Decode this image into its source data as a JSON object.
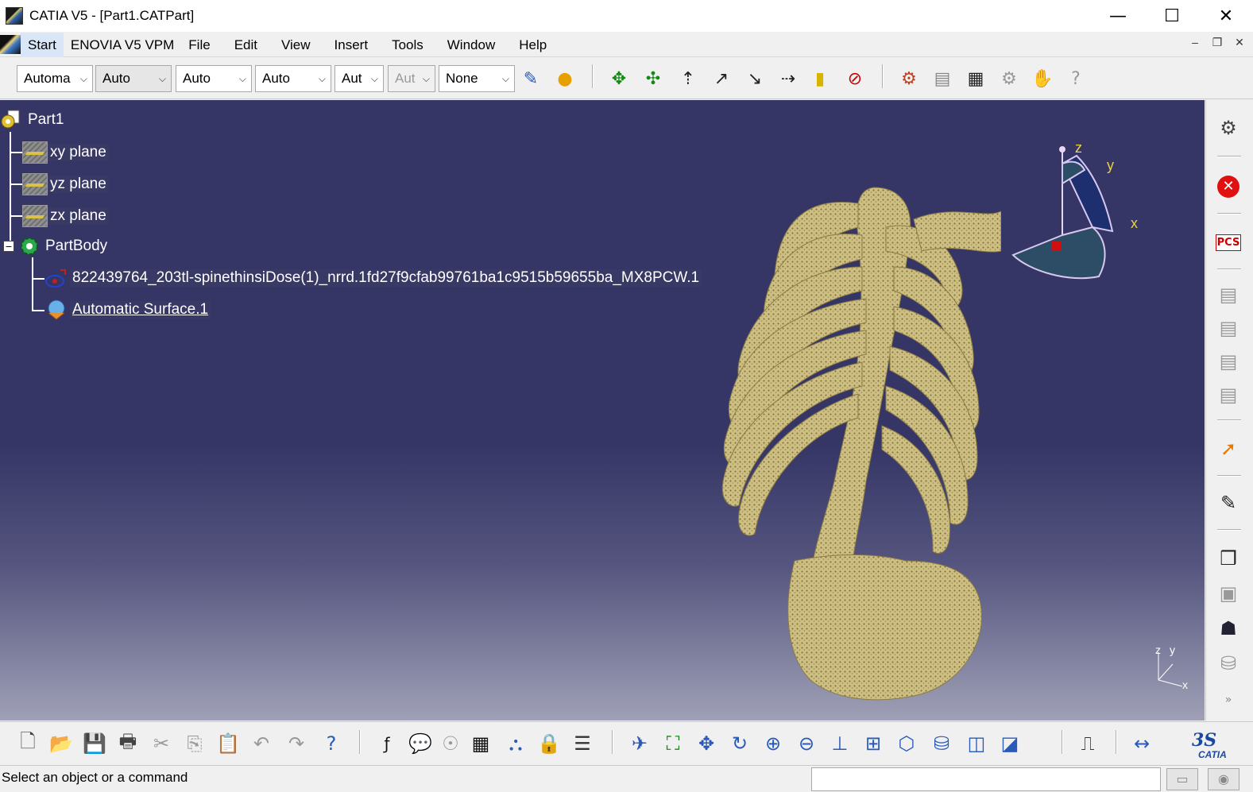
{
  "window": {
    "title": "CATIA V5 - [Part1.CATPart]",
    "minimize": "—",
    "maximize": "☐",
    "close": "✕"
  },
  "menu": {
    "items": [
      "Start",
      "ENOVIA V5 VPM",
      "File",
      "Edit",
      "View",
      "Insert",
      "Tools",
      "Window",
      "Help"
    ],
    "mdi_minimize": "–",
    "mdi_restore": "❐",
    "mdi_close": "✕"
  },
  "toolbar_top": {
    "combos": [
      "Automa",
      "Auto",
      "Auto",
      "Auto",
      "Aut",
      "Aut",
      "None"
    ],
    "combo_arrow": "⌵"
  },
  "tree": {
    "root": "Part1",
    "planes": [
      "xy plane",
      "yz plane",
      "zx plane"
    ],
    "body": "PartBody",
    "children": [
      "822439764_203tl-spinethinsiDose(1)_nrrd.1fd27f9cfab99761ba1c9515b59655ba_MX8PCW.1",
      "Automatic Surface.1"
    ],
    "collapse_sign": "−"
  },
  "compass": {
    "x": "x",
    "y": "y",
    "z": "z"
  },
  "axis_triad": {
    "x": "x",
    "y": "y",
    "z": "z"
  },
  "right_toolbar": {
    "pcs_label": "PCS"
  },
  "status": {
    "prompt": "Select an object or a command",
    "command_value": ""
  },
  "brand": {
    "catia_label": "CATIA"
  },
  "colors": {
    "viewport_top": "#353566",
    "viewport_bottom": "#9fa0b6",
    "model": "#cdbf83",
    "compass_fill": "#2d4d66",
    "axis_label": "#e8d14e"
  }
}
